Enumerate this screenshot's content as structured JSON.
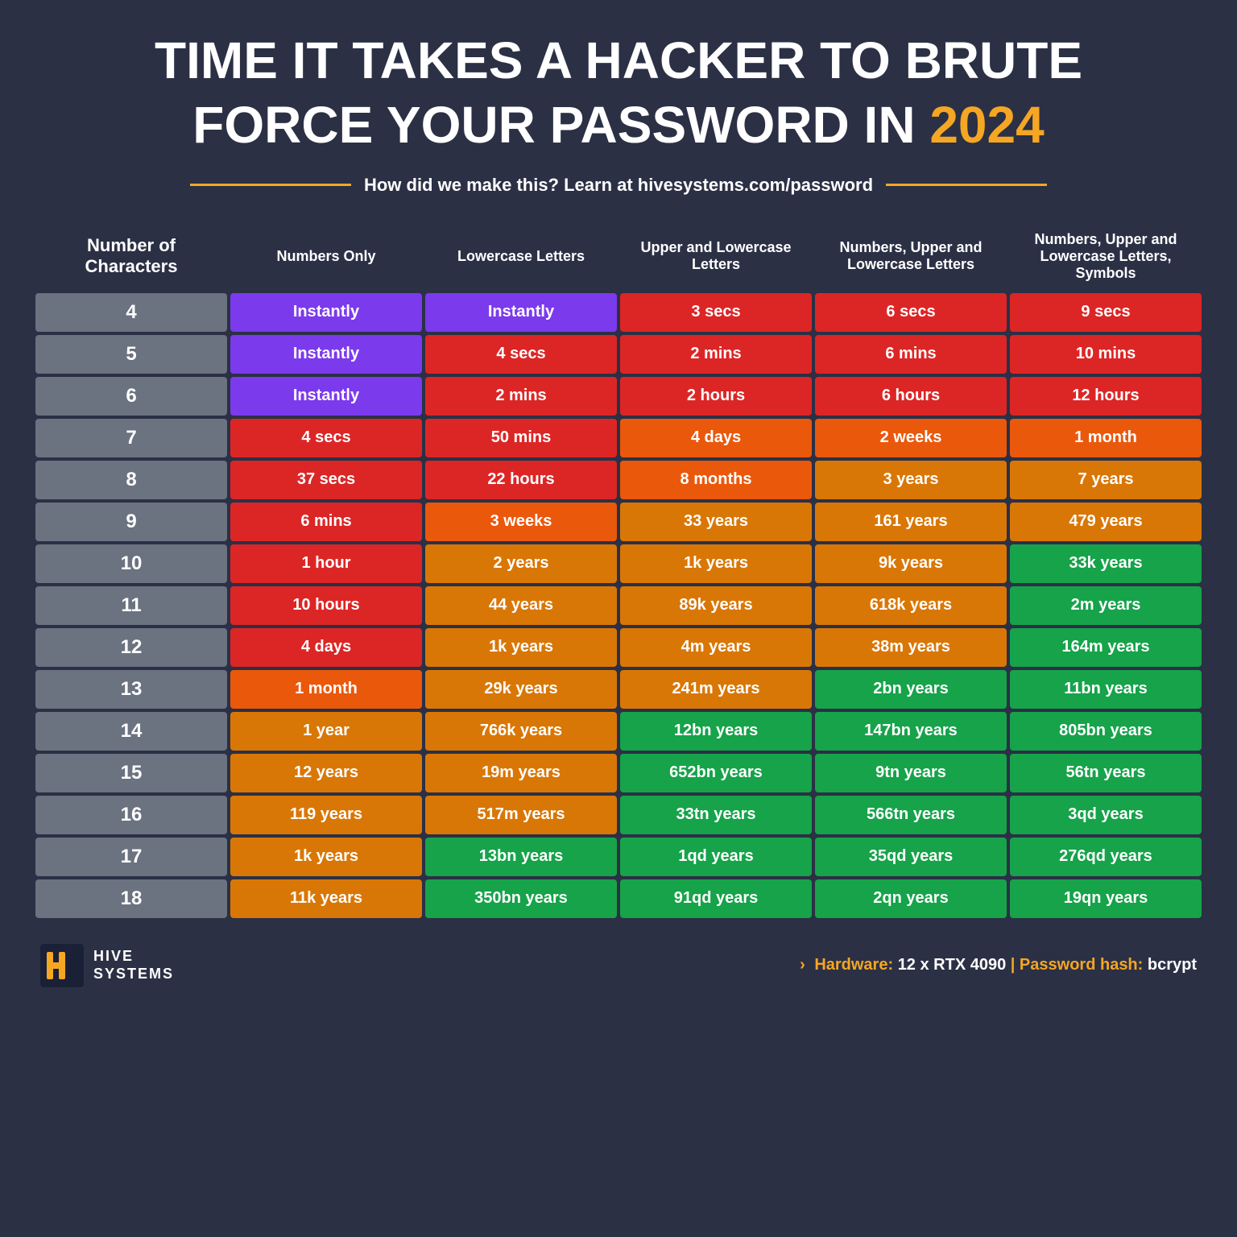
{
  "title": {
    "line1": "TIME IT TAKES A HACKER TO BRUTE",
    "line2": "FORCE YOUR PASSWORD IN ",
    "year": "2024"
  },
  "subtitle": "How did we make this? Learn at hivesystems.com/password",
  "columns": [
    "Number of Characters",
    "Numbers Only",
    "Lowercase Letters",
    "Upper and Lowercase Letters",
    "Numbers, Upper and Lowercase Letters",
    "Numbers, Upper and Lowercase Letters, Symbols"
  ],
  "rows": [
    {
      "chars": "4",
      "values": [
        "Instantly",
        "Instantly",
        "3 secs",
        "6 secs",
        "9 secs"
      ],
      "colors": [
        "c-purple",
        "c-purple",
        "c-red",
        "c-red",
        "c-red"
      ]
    },
    {
      "chars": "5",
      "values": [
        "Instantly",
        "4 secs",
        "2 mins",
        "6 mins",
        "10 mins"
      ],
      "colors": [
        "c-purple",
        "c-red",
        "c-red",
        "c-red",
        "c-red"
      ]
    },
    {
      "chars": "6",
      "values": [
        "Instantly",
        "2 mins",
        "2 hours",
        "6 hours",
        "12 hours"
      ],
      "colors": [
        "c-purple",
        "c-red",
        "c-red",
        "c-red",
        "c-red"
      ]
    },
    {
      "chars": "7",
      "values": [
        "4 secs",
        "50 mins",
        "4 days",
        "2 weeks",
        "1 month"
      ],
      "colors": [
        "c-red",
        "c-red",
        "c-orange",
        "c-orange",
        "c-orange"
      ]
    },
    {
      "chars": "8",
      "values": [
        "37 secs",
        "22 hours",
        "8 months",
        "3 years",
        "7 years"
      ],
      "colors": [
        "c-red",
        "c-red",
        "c-orange",
        "c-yellow",
        "c-yellow"
      ]
    },
    {
      "chars": "9",
      "values": [
        "6 mins",
        "3 weeks",
        "33 years",
        "161 years",
        "479 years"
      ],
      "colors": [
        "c-red",
        "c-orange",
        "c-yellow",
        "c-yellow",
        "c-yellow"
      ]
    },
    {
      "chars": "10",
      "values": [
        "1 hour",
        "2 years",
        "1k years",
        "9k years",
        "33k years"
      ],
      "colors": [
        "c-red",
        "c-yellow",
        "c-yellow",
        "c-yellow",
        "c-green"
      ]
    },
    {
      "chars": "11",
      "values": [
        "10 hours",
        "44 years",
        "89k years",
        "618k years",
        "2m years"
      ],
      "colors": [
        "c-red",
        "c-yellow",
        "c-yellow",
        "c-yellow",
        "c-green"
      ]
    },
    {
      "chars": "12",
      "values": [
        "4 days",
        "1k years",
        "4m years",
        "38m years",
        "164m years"
      ],
      "colors": [
        "c-red",
        "c-yellow",
        "c-yellow",
        "c-yellow",
        "c-green"
      ]
    },
    {
      "chars": "13",
      "values": [
        "1 month",
        "29k years",
        "241m years",
        "2bn years",
        "11bn years"
      ],
      "colors": [
        "c-orange",
        "c-yellow",
        "c-yellow",
        "c-green",
        "c-green"
      ]
    },
    {
      "chars": "14",
      "values": [
        "1 year",
        "766k years",
        "12bn years",
        "147bn years",
        "805bn years"
      ],
      "colors": [
        "c-yellow",
        "c-yellow",
        "c-green",
        "c-green",
        "c-green"
      ]
    },
    {
      "chars": "15",
      "values": [
        "12 years",
        "19m years",
        "652bn years",
        "9tn years",
        "56tn years"
      ],
      "colors": [
        "c-yellow",
        "c-yellow",
        "c-green",
        "c-green",
        "c-green"
      ]
    },
    {
      "chars": "16",
      "values": [
        "119 years",
        "517m years",
        "33tn years",
        "566tn years",
        "3qd years"
      ],
      "colors": [
        "c-yellow",
        "c-yellow",
        "c-green",
        "c-green",
        "c-green"
      ]
    },
    {
      "chars": "17",
      "values": [
        "1k years",
        "13bn years",
        "1qd years",
        "35qd years",
        "276qd years"
      ],
      "colors": [
        "c-yellow",
        "c-green",
        "c-green",
        "c-green",
        "c-green"
      ]
    },
    {
      "chars": "18",
      "values": [
        "11k years",
        "350bn years",
        "91qd years",
        "2qn years",
        "19qn years"
      ],
      "colors": [
        "c-yellow",
        "c-green",
        "c-green",
        "c-green",
        "c-green"
      ]
    }
  ],
  "footer": {
    "logo_line1": "HIVE",
    "logo_line2": "SYSTEMS",
    "hardware_label": "Hardware: ",
    "hardware_value": "12 x RTX 4090",
    "hash_label": " | Password hash: ",
    "hash_value": "bcrypt"
  }
}
